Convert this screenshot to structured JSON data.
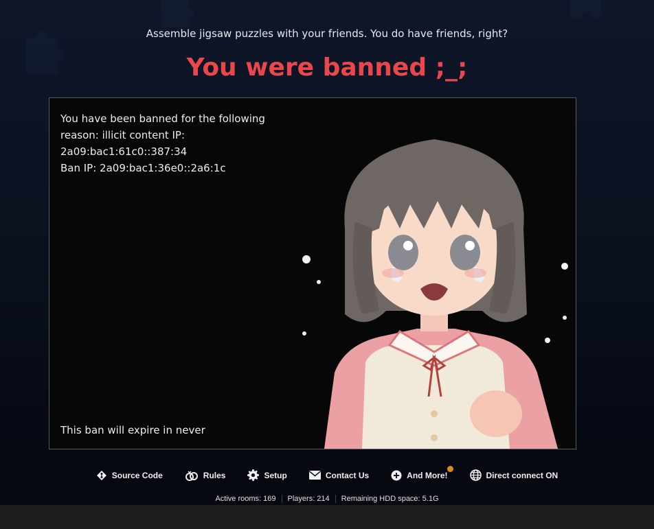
{
  "header": {
    "tagline": "Assemble jigsaw puzzles with your friends. You do have friends, right?",
    "title": "You were banned ;_;"
  },
  "ban": {
    "line1": "You have been banned for the following",
    "line2": "reason: illicit content IP: 2a09:bac1:61c0::387:34",
    "line3": "Ban IP: 2a09:bac1:36e0::2a6:1c",
    "expire": "This ban will expire in never",
    "image": "crying-anime-girl"
  },
  "footer": {
    "links": [
      {
        "label": "Source Code",
        "icon": "git-icon"
      },
      {
        "label": "Rules",
        "icon": "rings-icon"
      },
      {
        "label": "Setup",
        "icon": "gear-icon"
      },
      {
        "label": "Contact Us",
        "icon": "envelope-icon"
      },
      {
        "label": "And More!",
        "icon": "plus-circle-icon"
      },
      {
        "label": "Direct connect ON",
        "icon": "globe-icon"
      }
    ],
    "stats": {
      "rooms": "Active rooms: 169",
      "players": "Players: 214",
      "hdd": "Remaining HDD space: 5.1G"
    }
  },
  "colors": {
    "title": "#e9474c",
    "background": "#0b1220",
    "panel": "#070707",
    "notify_dot": "#d98a1a"
  }
}
